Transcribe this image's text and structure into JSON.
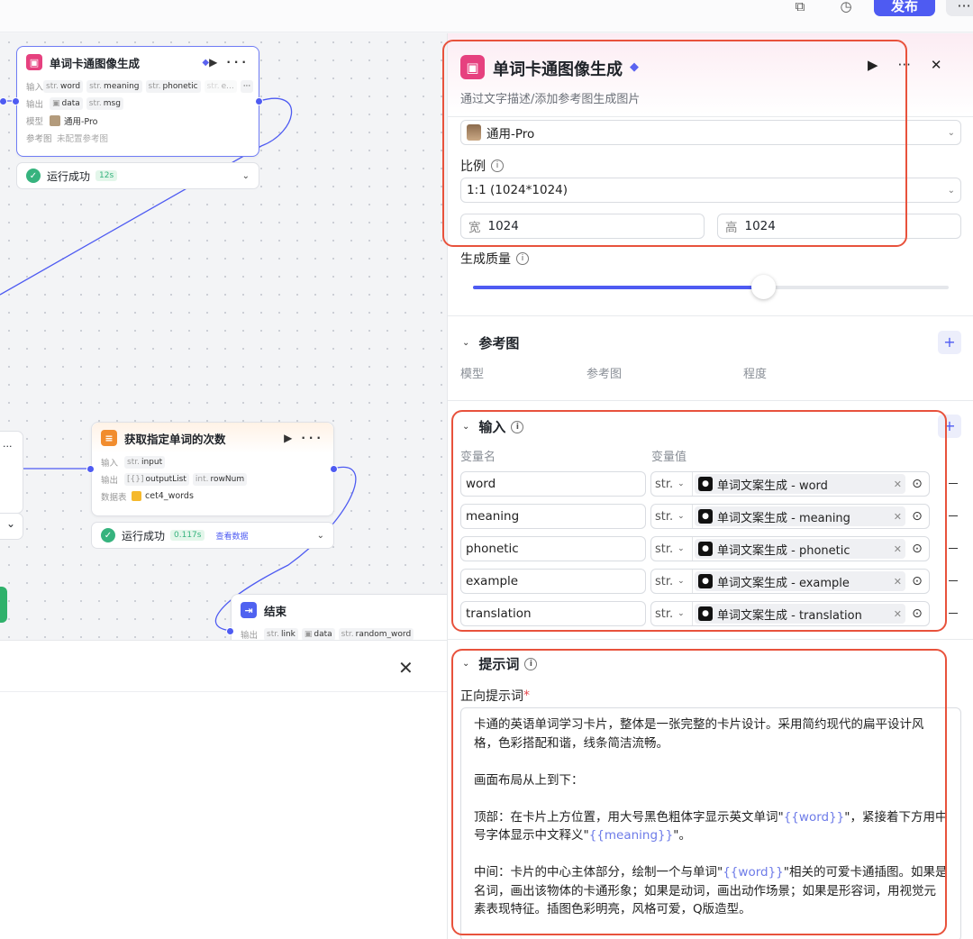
{
  "topbar": {
    "publish_label": "发布",
    "more_label": "···",
    "icons": [
      "copy-icon",
      "history-icon"
    ]
  },
  "canvas": {
    "image_node": {
      "title": "单词卡通图像生成",
      "run_icon": "▶",
      "more": "···",
      "input_label": "输入",
      "inputs": [
        {
          "type": "str.",
          "name": "word"
        },
        {
          "type": "str.",
          "name": "meaning"
        },
        {
          "type": "str.",
          "name": "phonetic"
        },
        {
          "type": "str.",
          "name": "e..."
        }
      ],
      "inputs_more": "···",
      "output_label": "输出",
      "outputs": [
        {
          "type": "▣",
          "name": "data"
        },
        {
          "type": "str.",
          "name": "msg"
        }
      ],
      "model_label": "模型",
      "model_value": "通用-Pro",
      "ref_label": "参考图",
      "ref_value": "未配置参考图",
      "status_text": "运行成功",
      "duration": "12s"
    },
    "db_node": {
      "title": "获取指定单词的次数",
      "run_icon": "▶",
      "more": "···",
      "input_label": "输入",
      "inputs": [
        {
          "type": "str.",
          "name": "input"
        }
      ],
      "output_label": "输出",
      "outputs": [
        {
          "type": "[{}]",
          "name": "outputList"
        },
        {
          "type": "int.",
          "name": "rowNum"
        }
      ],
      "table_label": "数据表",
      "table_value": "cet4_words",
      "status_text": "运行成功",
      "duration": "0.117s",
      "view_data": "查看数据"
    },
    "end_node": {
      "title": "结束",
      "output_label": "输出",
      "outputs": [
        {
          "type": "str.",
          "name": "link"
        },
        {
          "type": "▣",
          "name": "data"
        },
        {
          "type": "str.",
          "name": "random_word"
        }
      ]
    },
    "left_fragment": {
      "more": "···",
      "chevron": "⌄"
    }
  },
  "bottom_panel": {
    "close": "✕"
  },
  "panel": {
    "title": "单词卡通图像生成",
    "description": "通过文字描述/添加参考图生成图片",
    "run_icon": "▶",
    "more_icon": "···",
    "close_icon": "✕",
    "model": "通用-Pro",
    "ratio_label": "比例",
    "ratio_value": "1:1 (1024*1024)",
    "width_label": "宽",
    "width_value": "1024",
    "height_label": "高",
    "height_value": "1024",
    "quality_label": "生成质量",
    "quality_level": 0.61,
    "reference": {
      "title": "参考图",
      "cols": [
        "模型",
        "参考图",
        "程度"
      ],
      "add": "+"
    },
    "inputs": {
      "title": "输入",
      "add": "+",
      "col_name": "变量名",
      "col_value": "变量值",
      "rows": [
        {
          "name": "word",
          "type": "str.",
          "ref": "单词文案生成 - word"
        },
        {
          "name": "meaning",
          "type": "str.",
          "ref": "单词文案生成 - meaning"
        },
        {
          "name": "phonetic",
          "type": "str.",
          "ref": "单词文案生成 - phonetic"
        },
        {
          "name": "example",
          "type": "str.",
          "ref": "单词文案生成 - example"
        },
        {
          "name": "translation",
          "type": "str.",
          "ref": "单词文案生成 - translation"
        }
      ]
    },
    "prompt": {
      "title": "提示词",
      "positive_label": "正向提示词",
      "required_mark": "*",
      "p1": "卡通的英语单词学习卡片，整体是一张完整的卡片设计。采用简约现代的扁平设计风格，色彩搭配和谐，线条简洁流畅。",
      "p2": "画面布局从上到下：",
      "p3_a": "顶部：在卡片上方位置，用大号黑色粗体字显示英文单词\"",
      "p3_word": "{{word}}",
      "p3_b": "\"，紧接着下方用中号字体显示中文释义\"",
      "p3_meaning": "{{meaning}}",
      "p3_c": "\"。",
      "p4_a": "中间：卡片的中心主体部分，绘制一个与单词\"",
      "p4_word": "{{word}}",
      "p4_b": "\"相关的可爱卡通插图。如果是名词，画出该物体的卡通形象；如果是动词，画出动作场景；如果是形容词，用视觉元素表现特征。插图色彩明亮，风格可爱，Q版造型。"
    }
  }
}
